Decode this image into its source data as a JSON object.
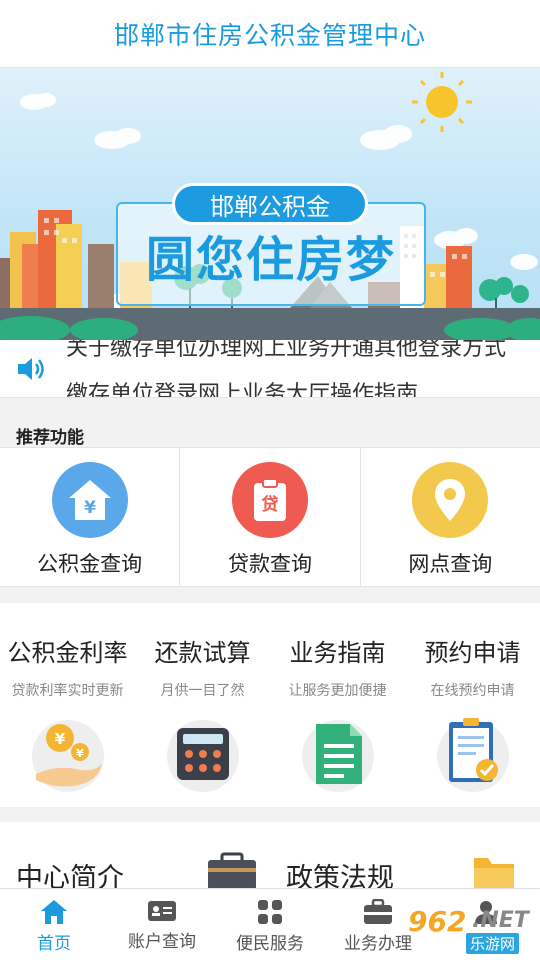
{
  "header": {
    "title": "邯郸市住房公积金管理中心"
  },
  "banner": {
    "badge": "邯郸公积金",
    "slogan": "圆您住房梦"
  },
  "notice": {
    "icon": "speaker-icon",
    "lines": [
      "关于缴存单位办理网上业务开通其他登录方式",
      "缴存单位登录网上业务大厅操作指南"
    ]
  },
  "recommended": {
    "title": "推荐功能",
    "items": [
      {
        "label": "公积金查询",
        "icon": "house-yen-icon",
        "color": "#5aa8ea"
      },
      {
        "label": "贷款查询",
        "icon": "loan-clipboard-icon",
        "color": "#ef5b50"
      },
      {
        "label": "网点查询",
        "icon": "location-pin-icon",
        "color": "#f2c94c"
      }
    ]
  },
  "services": [
    {
      "title": "公积金利率",
      "subtitle": "贷款利率实时更新",
      "icon": "coins-hand-icon"
    },
    {
      "title": "还款试算",
      "subtitle": "月供一目了然",
      "icon": "calculator-icon"
    },
    {
      "title": "业务指南",
      "subtitle": "让服务更加便捷",
      "icon": "document-icon"
    },
    {
      "title": "预约申请",
      "subtitle": "在线预约申请",
      "icon": "clipboard-check-icon"
    }
  ],
  "more": [
    {
      "title": "中心简介",
      "icon": "briefcase-icon"
    },
    {
      "title": "政策法规",
      "icon": "folder-icon"
    }
  ],
  "tabbar": {
    "tabs": [
      {
        "label": "首页",
        "icon": "home-icon",
        "active": true
      },
      {
        "label": "账户查询",
        "icon": "id-card-icon",
        "active": false
      },
      {
        "label": "便民服务",
        "icon": "grid-icon",
        "active": false
      },
      {
        "label": "业务办理",
        "icon": "toolbox-icon",
        "active": false
      },
      {
        "label": "",
        "icon": "user-icon",
        "active": false
      }
    ]
  },
  "watermark": {
    "brand": "962",
    "domain": ".NET",
    "site": "乐游网"
  },
  "colors": {
    "accent": "#1a9be0",
    "background": "#f2f2f2"
  }
}
